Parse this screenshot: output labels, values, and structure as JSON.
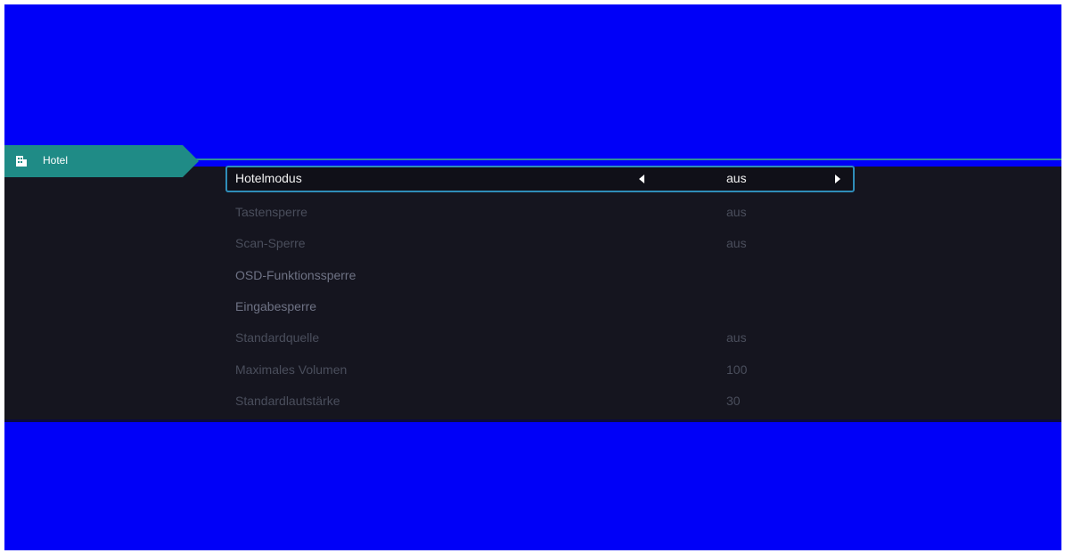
{
  "sidebar": {
    "tab_label": "Hotel",
    "tab_icon": "hotel-building-icon",
    "tab_color": "#1f8b86"
  },
  "menu": {
    "selected_border_color": "#2f8db9",
    "items": [
      {
        "label": "Hotelmodus",
        "value": "aus",
        "left_arrow": "chevron-left-icon",
        "right_arrow": "chevron-right-icon"
      },
      {
        "label": "Tastensperre",
        "value": "aus"
      },
      {
        "label": "Scan-Sperre",
        "value": "aus"
      },
      {
        "label": "OSD-Funktionssperre",
        "value": ""
      },
      {
        "label": "Eingabesperre",
        "value": ""
      },
      {
        "label": "Standardquelle",
        "value": "aus"
      },
      {
        "label": "Maximales Volumen",
        "value": "100"
      },
      {
        "label": "Standardlautstärke",
        "value": "30"
      }
    ]
  }
}
